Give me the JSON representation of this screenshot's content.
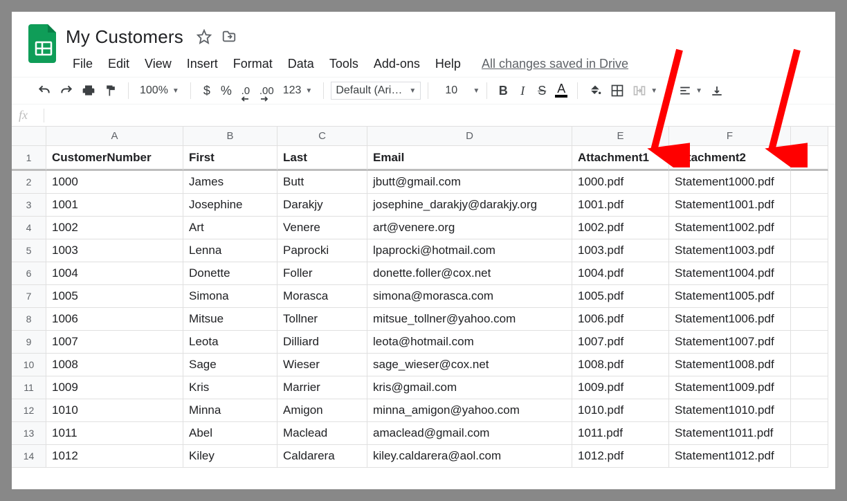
{
  "doc_title": "My Customers",
  "menus": [
    "File",
    "Edit",
    "View",
    "Insert",
    "Format",
    "Data",
    "Tools",
    "Add-ons",
    "Help"
  ],
  "save_status": "All changes saved in Drive",
  "toolbar": {
    "zoom": "100%",
    "currency": "$",
    "percent": "%",
    "dec_dec": ".0",
    "dec_inc": ".00",
    "more_fmt": "123",
    "font": "Default (Ari…",
    "font_size": "10"
  },
  "fx_label": "fx",
  "columns": [
    "A",
    "B",
    "C",
    "D",
    "E",
    "F",
    ""
  ],
  "rows": [
    {
      "n": "1",
      "cells": [
        "CustomerNumber",
        "First",
        "Last",
        "Email",
        "Attachment1",
        "Attachment2",
        ""
      ]
    },
    {
      "n": "2",
      "cells": [
        "1000",
        "James",
        "Butt",
        "jbutt@gmail.com",
        "1000.pdf",
        "Statement1000.pdf",
        ""
      ]
    },
    {
      "n": "3",
      "cells": [
        "1001",
        "Josephine",
        "Darakjy",
        "josephine_darakjy@darakjy.org",
        "1001.pdf",
        "Statement1001.pdf",
        ""
      ]
    },
    {
      "n": "4",
      "cells": [
        "1002",
        "Art",
        "Venere",
        "art@venere.org",
        "1002.pdf",
        "Statement1002.pdf",
        ""
      ]
    },
    {
      "n": "5",
      "cells": [
        "1003",
        "Lenna",
        "Paprocki",
        "lpaprocki@hotmail.com",
        "1003.pdf",
        "Statement1003.pdf",
        ""
      ]
    },
    {
      "n": "6",
      "cells": [
        "1004",
        "Donette",
        "Foller",
        "donette.foller@cox.net",
        "1004.pdf",
        "Statement1004.pdf",
        ""
      ]
    },
    {
      "n": "7",
      "cells": [
        "1005",
        "Simona",
        "Morasca",
        "simona@morasca.com",
        "1005.pdf",
        "Statement1005.pdf",
        ""
      ]
    },
    {
      "n": "8",
      "cells": [
        "1006",
        "Mitsue",
        "Tollner",
        "mitsue_tollner@yahoo.com",
        "1006.pdf",
        "Statement1006.pdf",
        ""
      ]
    },
    {
      "n": "9",
      "cells": [
        "1007",
        "Leota",
        "Dilliard",
        "leota@hotmail.com",
        "1007.pdf",
        "Statement1007.pdf",
        ""
      ]
    },
    {
      "n": "10",
      "cells": [
        "1008",
        "Sage",
        "Wieser",
        "sage_wieser@cox.net",
        "1008.pdf",
        "Statement1008.pdf",
        ""
      ]
    },
    {
      "n": "11",
      "cells": [
        "1009",
        "Kris",
        "Marrier",
        "kris@gmail.com",
        "1009.pdf",
        "Statement1009.pdf",
        ""
      ]
    },
    {
      "n": "12",
      "cells": [
        "1010",
        "Minna",
        "Amigon",
        "minna_amigon@yahoo.com",
        "1010.pdf",
        "Statement1010.pdf",
        ""
      ]
    },
    {
      "n": "13",
      "cells": [
        "1011",
        "Abel",
        "Maclead",
        "amaclead@gmail.com",
        "1011.pdf",
        "Statement1011.pdf",
        ""
      ]
    },
    {
      "n": "14",
      "cells": [
        "1012",
        "Kiley",
        "Caldarera",
        "kiley.caldarera@aol.com",
        "1012.pdf",
        "Statement1012.pdf",
        ""
      ]
    }
  ]
}
